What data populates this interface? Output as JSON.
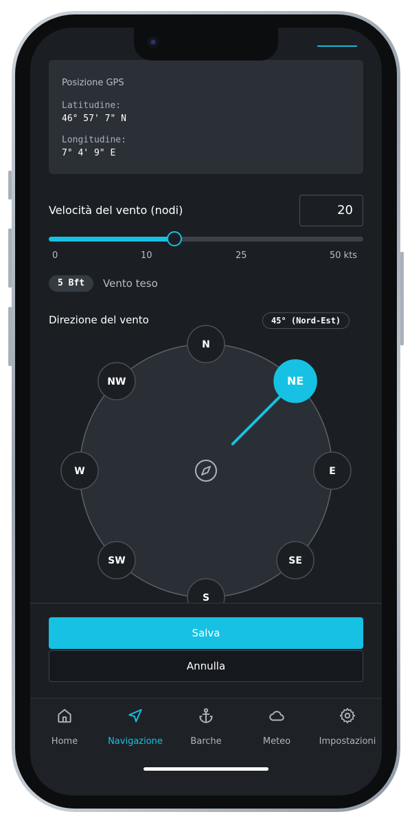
{
  "gps": {
    "title": "Posizione GPS",
    "latitude_label": "Latitudine:",
    "latitude_value": "46° 57' 7\" N",
    "longitude_label": "Longitudine:",
    "longitude_value": "7° 4' 9\" E"
  },
  "wind_speed": {
    "label": "Velocità del vento (nodi)",
    "value": "20",
    "slider_min": 0,
    "slider_max": 50,
    "slider_value": 20,
    "ticks": [
      "0",
      "10",
      "25",
      "50 kts"
    ],
    "beaufort_badge": "5 Bft",
    "beaufort_text": "Vento teso"
  },
  "wind_direction": {
    "label": "Direzione del vento",
    "badge": "45° (Nord-Est)",
    "degrees": 45,
    "points": [
      "N",
      "NE",
      "E",
      "SE",
      "S",
      "SW",
      "W",
      "NW"
    ],
    "selected": "NE"
  },
  "actions": {
    "save_label": "Salva",
    "cancel_label": "Annulla"
  },
  "tabbar": {
    "items": [
      {
        "label": "Home",
        "icon": "home-icon"
      },
      {
        "label": "Navigazione",
        "icon": "navigation-arrow-icon"
      },
      {
        "label": "Barche",
        "icon": "anchor-icon"
      },
      {
        "label": "Meteo",
        "icon": "cloud-icon"
      },
      {
        "label": "Impostazioni",
        "icon": "gear-icon"
      }
    ],
    "active_index": 1
  },
  "colors": {
    "accent": "#16c1e3",
    "background": "#1b1f24",
    "card": "#2b3036"
  }
}
